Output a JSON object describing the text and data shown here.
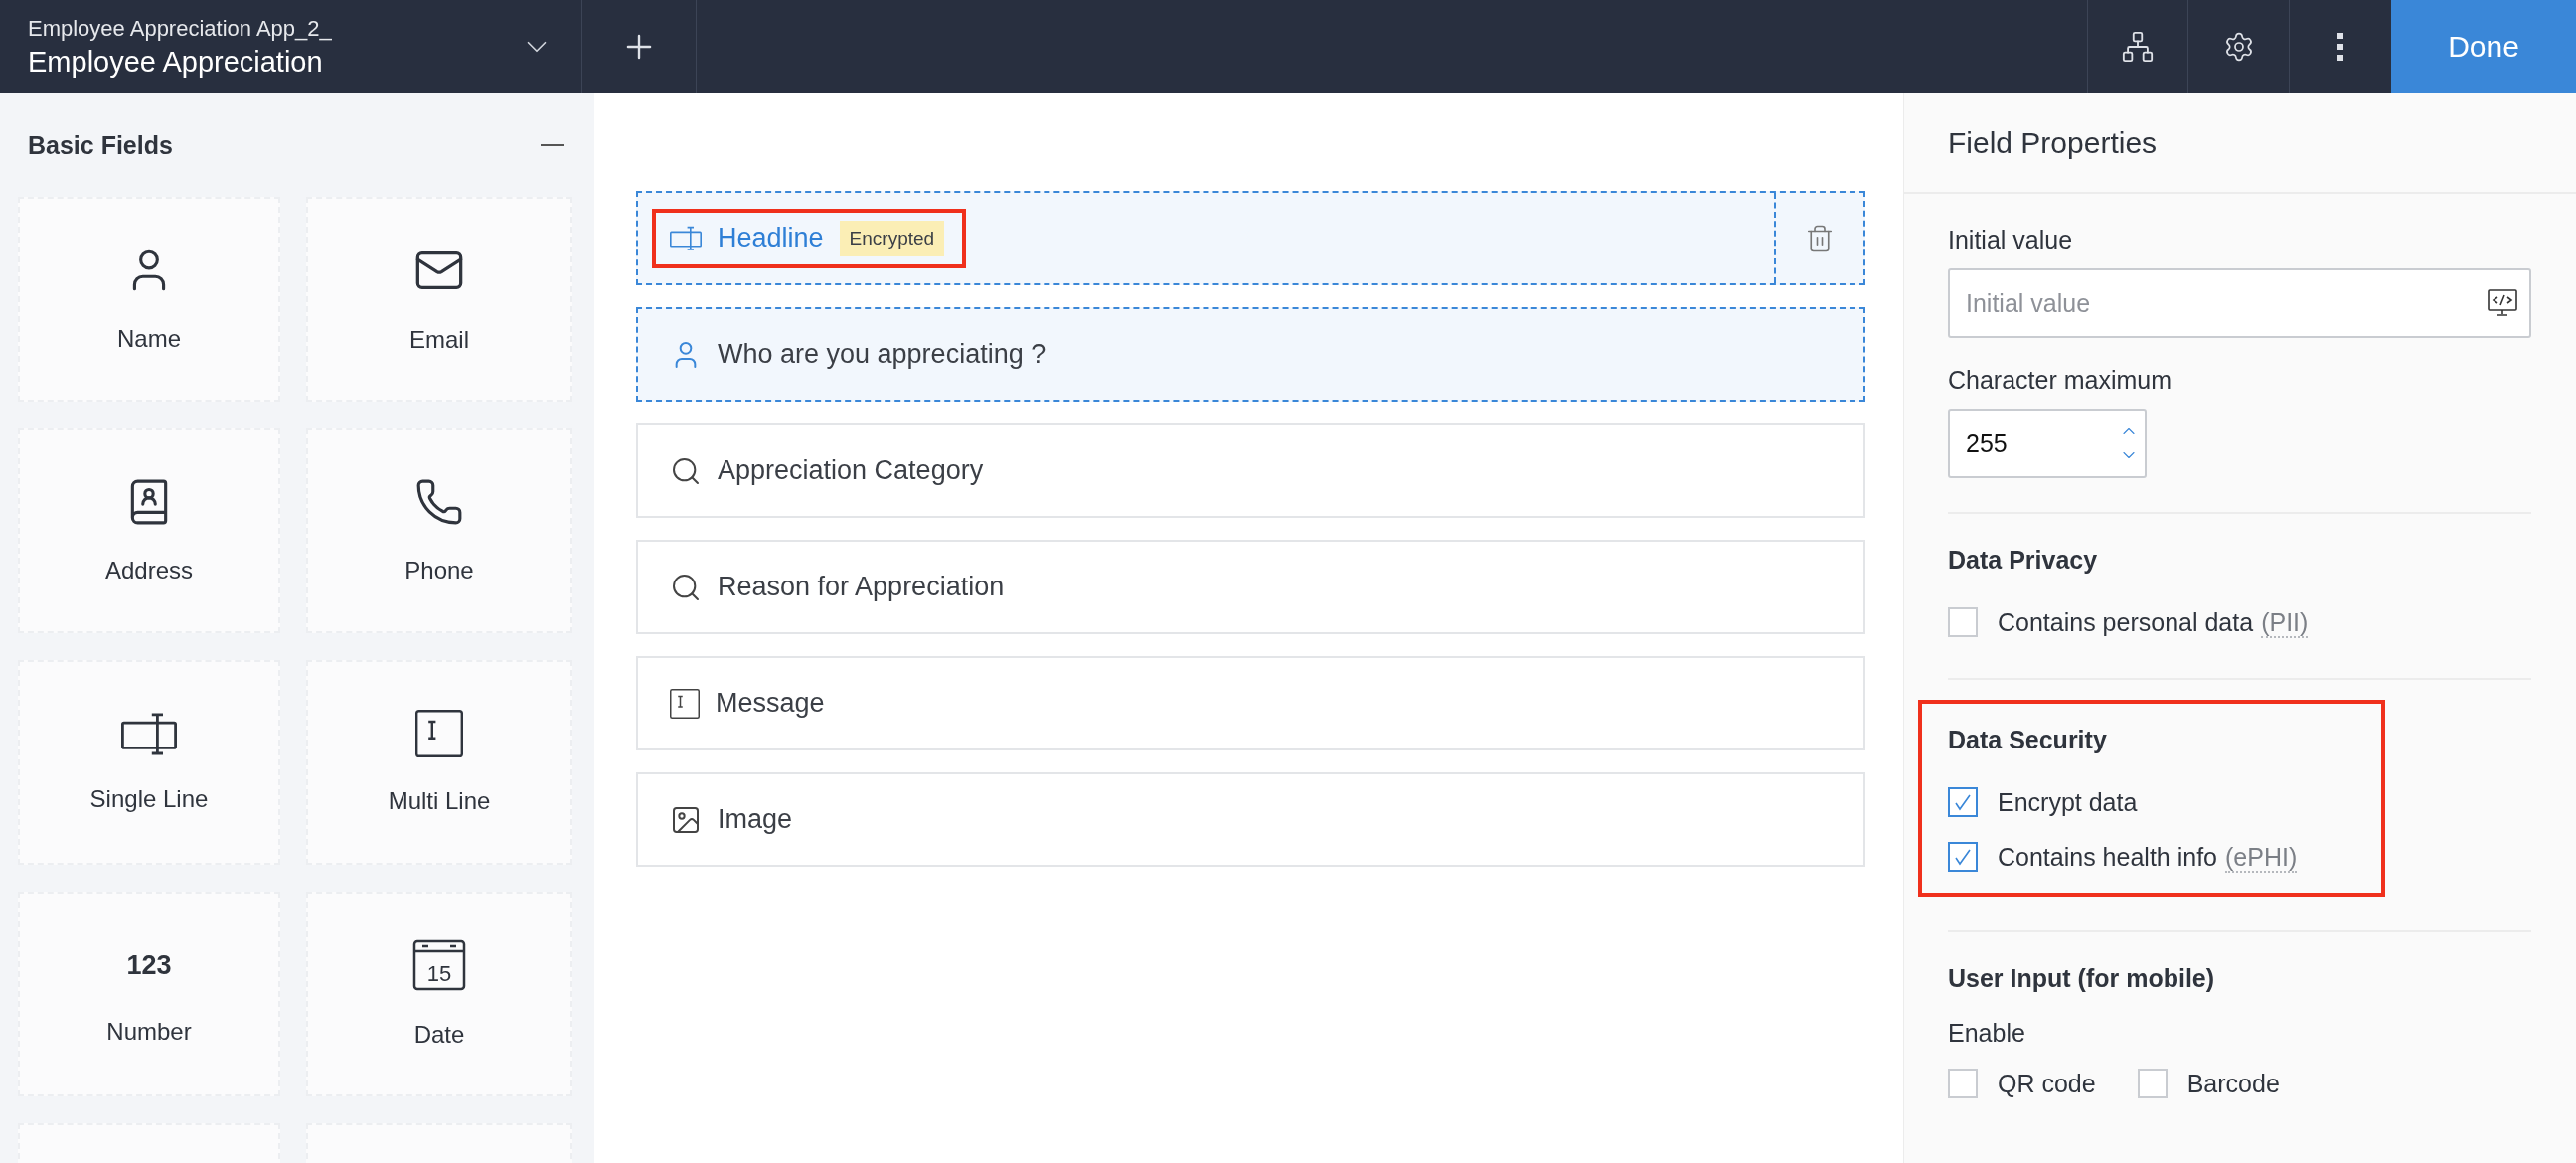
{
  "app": {
    "subtitle": "Employee Appreciation App_2_",
    "title": "Employee Appreciation"
  },
  "toolbar": {
    "done": "Done"
  },
  "sidebar": {
    "title": "Basic Fields",
    "fields": [
      {
        "kind": "name",
        "label": "Name"
      },
      {
        "kind": "email",
        "label": "Email"
      },
      {
        "kind": "address",
        "label": "Address"
      },
      {
        "kind": "phone",
        "label": "Phone"
      },
      {
        "kind": "single-line",
        "label": "Single Line"
      },
      {
        "kind": "multi-line",
        "label": "Multi Line"
      },
      {
        "kind": "number",
        "label": "Number",
        "icon_text": "123"
      },
      {
        "kind": "date",
        "label": "Date",
        "icon_text": "15"
      }
    ]
  },
  "form_fields": [
    {
      "kind": "single-line",
      "label": "Headline",
      "badge": "Encrypted",
      "selected": true,
      "highlighted": true
    },
    {
      "kind": "name",
      "label": "Who are you appreciating ?",
      "selected": false,
      "highlighted": true
    },
    {
      "kind": "lookup",
      "label": "Appreciation Category",
      "selected": false,
      "highlighted": false
    },
    {
      "kind": "lookup",
      "label": "Reason for Appreciation",
      "selected": false,
      "highlighted": false
    },
    {
      "kind": "multi-line",
      "label": "Message",
      "selected": false,
      "highlighted": false
    },
    {
      "kind": "image",
      "label": "Image",
      "selected": false,
      "highlighted": false
    }
  ],
  "properties": {
    "title": "Field Properties",
    "initial_value": {
      "label": "Initial value",
      "placeholder": "Initial value"
    },
    "character_maximum": {
      "label": "Character maximum",
      "value": "255"
    },
    "data_privacy": {
      "title": "Data Privacy",
      "options": [
        {
          "label": "Contains personal data",
          "abbr": "(PII)",
          "checked": false
        }
      ]
    },
    "data_security": {
      "title": "Data Security",
      "options": [
        {
          "label": "Encrypt data",
          "checked": true
        },
        {
          "label": "Contains health info",
          "abbr": "(ePHI)",
          "checked": true
        }
      ]
    },
    "user_input": {
      "title": "User Input (for mobile)",
      "enable_label": "Enable",
      "options": [
        {
          "label": "QR code",
          "checked": false
        },
        {
          "label": "Barcode",
          "checked": false
        }
      ]
    }
  }
}
